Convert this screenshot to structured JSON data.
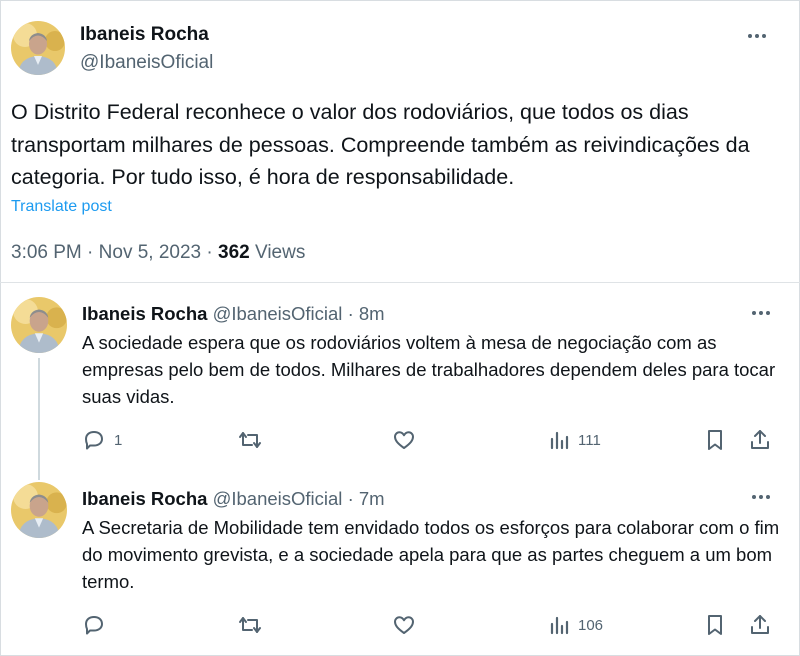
{
  "main": {
    "author_name": "Ibaneis Rocha",
    "handle": "@IbaneisOficial",
    "text": "O Distrito Federal reconhece o valor dos rodoviários, que todos os dias transportam milhares de pessoas. Compreende também as reivindicações da categoria. Por tudo isso, é hora de responsabilidade.",
    "translate_label": "Translate post",
    "time": "3:06 PM",
    "date": "Nov 5, 2023",
    "sep": "·",
    "views_count": "362",
    "views_label": "Views"
  },
  "replies": [
    {
      "author_name": "Ibaneis Rocha",
      "handle": "@IbaneisOficial",
      "dot": "·",
      "time_ago": "8m",
      "text": "A sociedade espera que os rodoviários voltem à mesa de negociação com as empresas pelo bem de todos. Milhares de trabalhadores dependem deles para tocar suas vidas.",
      "reply_count": "1",
      "views_count": "111"
    },
    {
      "author_name": "Ibaneis Rocha",
      "handle": "@IbaneisOficial",
      "dot": "·",
      "time_ago": "7m",
      "text": "A Secretaria de Mobilidade tem envidado todos os esforços para colaborar com o fim do movimento grevista, e a sociedade apela para que as partes cheguem a um bom termo.",
      "reply_count": "",
      "views_count": "106"
    }
  ],
  "icons": {
    "more": "more-horizontal-icon",
    "reply": "comment-icon",
    "retweet": "retweet-icon",
    "like": "heart-icon",
    "views": "analytics-icon",
    "bookmark": "bookmark-icon",
    "share": "share-icon"
  },
  "colors": {
    "text": "#0f1419",
    "secondary": "#536471",
    "link": "#1d9bf0",
    "border": "#dfe3e6"
  }
}
